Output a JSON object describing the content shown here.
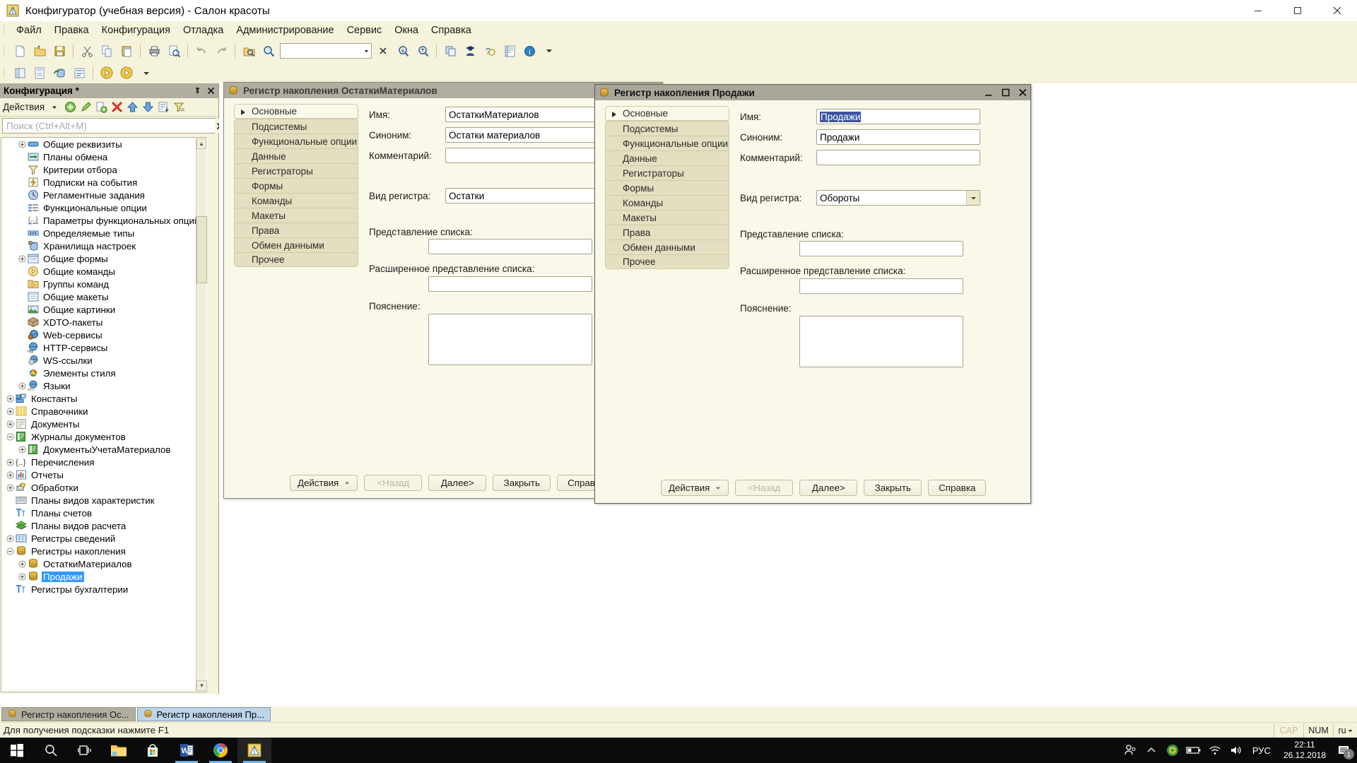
{
  "window": {
    "title": "Конфигуратор (учебная версия) - Салон красоты",
    "app_icon": "1c-configurator-icon",
    "minimize": "minimize-icon",
    "maximize": "maximize-icon",
    "close": "close-icon"
  },
  "menubar": {
    "items": [
      {
        "label": "Файл",
        "accel": "Ф"
      },
      {
        "label": "Правка",
        "accel": "П"
      },
      {
        "label": "Конфигурация",
        "accel": "К"
      },
      {
        "label": "Отладка",
        "accel": "О"
      },
      {
        "label": "Администрирование",
        "accel": "А"
      },
      {
        "label": "Сервис",
        "accel": "С"
      },
      {
        "label": "Окна",
        "accel": "О"
      },
      {
        "label": "Справка",
        "accel": "а"
      }
    ]
  },
  "toolbar": {
    "search_value": "",
    "row1_icons": [
      "new-document-icon",
      "open-folder-icon",
      "save-icon",
      "cut-icon",
      "copy-icon",
      "paste-icon",
      "print-icon",
      "print-preview-icon",
      "undo-icon",
      "redo-icon",
      "find-in-files-icon",
      "search-icon"
    ],
    "row1_icons_after": [
      "find-next-icon",
      "find-prev-icon",
      "window-copy-icon",
      "user-icon",
      "help-question-icon",
      "syntax-helper-icon",
      "info-icon",
      "toolbar-overflow-icon"
    ],
    "row2_icons": [
      "config-window-icon",
      "config-save-icon",
      "update-db-icon",
      "config-support-icon",
      "start-debug-icon",
      "start-client-icon",
      "toolbar-overflow-icon"
    ]
  },
  "config_panel": {
    "header_title": "Конфигурация *",
    "pin_icon": "pin-icon",
    "close_icon": "close-icon",
    "actions_label": "Действия",
    "action_icons": [
      "add-icon",
      "edit-icon",
      "copy-add-icon",
      "delete-icon",
      "move-up-icon",
      "move-down-icon",
      "sort-icon",
      "filter-icon"
    ],
    "search_placeholder": "Поиск (Ctrl+Alt+M)",
    "search_value": "",
    "search_clear_icon": "close-icon",
    "tree": [
      {
        "label": "Общие реквизиты",
        "indent": 1,
        "toggle": "plus",
        "icon": "common-attribute-icon",
        "selected": false
      },
      {
        "label": "Планы обмена",
        "indent": 1,
        "toggle": "none",
        "icon": "exchange-plans-icon",
        "selected": false
      },
      {
        "label": "Критерии отбора",
        "indent": 1,
        "toggle": "none",
        "icon": "filter-criteria-icon",
        "selected": false
      },
      {
        "label": "Подписки на события",
        "indent": 1,
        "toggle": "none",
        "icon": "event-subscription-icon",
        "selected": false
      },
      {
        "label": "Регламентные задания",
        "indent": 1,
        "toggle": "none",
        "icon": "scheduled-job-icon",
        "selected": false
      },
      {
        "label": "Функциональные опции",
        "indent": 1,
        "toggle": "none",
        "icon": "functional-option-icon",
        "selected": false
      },
      {
        "label": "Параметры функциональных опций",
        "indent": 1,
        "toggle": "none",
        "icon": "functional-option-param-icon",
        "selected": false
      },
      {
        "label": "Определяемые типы",
        "indent": 1,
        "toggle": "none",
        "icon": "defined-type-icon",
        "selected": false
      },
      {
        "label": "Хранилища настроек",
        "indent": 1,
        "toggle": "none",
        "icon": "settings-storage-icon",
        "selected": false
      },
      {
        "label": "Общие формы",
        "indent": 1,
        "toggle": "plus",
        "icon": "common-form-icon",
        "selected": false
      },
      {
        "label": "Общие команды",
        "indent": 1,
        "toggle": "none",
        "icon": "common-command-icon",
        "selected": false
      },
      {
        "label": "Группы команд",
        "indent": 1,
        "toggle": "none",
        "icon": "command-group-icon",
        "selected": false
      },
      {
        "label": "Общие макеты",
        "indent": 1,
        "toggle": "none",
        "icon": "common-template-icon",
        "selected": false
      },
      {
        "label": "Общие картинки",
        "indent": 1,
        "toggle": "none",
        "icon": "common-picture-icon",
        "selected": false
      },
      {
        "label": "XDTO-пакеты",
        "indent": 1,
        "toggle": "none",
        "icon": "xdto-package-icon",
        "selected": false
      },
      {
        "label": "Web-сервисы",
        "indent": 1,
        "toggle": "none",
        "icon": "web-service-icon",
        "selected": false
      },
      {
        "label": "HTTP-сервисы",
        "indent": 1,
        "toggle": "none",
        "icon": "http-service-icon",
        "selected": false
      },
      {
        "label": "WS-ссылки",
        "indent": 1,
        "toggle": "none",
        "icon": "ws-link-icon",
        "selected": false
      },
      {
        "label": "Элементы стиля",
        "indent": 1,
        "toggle": "none",
        "icon": "style-element-icon",
        "selected": false
      },
      {
        "label": "Языки",
        "indent": 1,
        "toggle": "plus",
        "icon": "language-icon",
        "selected": false
      },
      {
        "label": "Константы",
        "indent": 0,
        "toggle": "plus",
        "icon": "constant-icon",
        "selected": false
      },
      {
        "label": "Справочники",
        "indent": 0,
        "toggle": "plus",
        "icon": "catalog-icon",
        "selected": false
      },
      {
        "label": "Документы",
        "indent": 0,
        "toggle": "plus",
        "icon": "document-icon",
        "selected": false
      },
      {
        "label": "Журналы документов",
        "indent": 0,
        "toggle": "minus",
        "icon": "doc-journal-icon",
        "selected": false
      },
      {
        "label": "ДокументыУчетаМатериалов",
        "indent": 1,
        "toggle": "plus",
        "icon": "doc-journal-icon",
        "selected": false
      },
      {
        "label": "Перечисления",
        "indent": 0,
        "toggle": "plus",
        "icon": "enum-icon",
        "selected": false
      },
      {
        "label": "Отчеты",
        "indent": 0,
        "toggle": "plus",
        "icon": "report-icon",
        "selected": false
      },
      {
        "label": "Обработки",
        "indent": 0,
        "toggle": "plus",
        "icon": "data-processor-icon",
        "selected": false
      },
      {
        "label": "Планы видов характеристик",
        "indent": 0,
        "toggle": "none",
        "icon": "chart-of-char-types-icon",
        "selected": false
      },
      {
        "label": "Планы счетов",
        "indent": 0,
        "toggle": "none",
        "icon": "chart-of-accounts-icon",
        "selected": false
      },
      {
        "label": "Планы видов расчета",
        "indent": 0,
        "toggle": "none",
        "icon": "chart-of-calc-types-icon",
        "selected": false
      },
      {
        "label": "Регистры сведений",
        "indent": 0,
        "toggle": "plus",
        "icon": "info-register-icon",
        "selected": false
      },
      {
        "label": "Регистры накопления",
        "indent": 0,
        "toggle": "minus",
        "icon": "accum-register-icon",
        "selected": false
      },
      {
        "label": "ОстаткиМатериалов",
        "indent": 1,
        "toggle": "plus",
        "icon": "accum-register-icon",
        "selected": false
      },
      {
        "label": "Продажи",
        "indent": 1,
        "toggle": "plus",
        "icon": "accum-register-icon",
        "selected": true
      },
      {
        "label": "Регистры бухгалтерии",
        "indent": 0,
        "toggle": "none",
        "icon": "accounting-register-icon",
        "selected": false
      }
    ]
  },
  "dialog_ostatki": {
    "title": "Регистр накопления ОстаткиМатериалов",
    "icon": "accum-register-icon",
    "minimize": "minimize-icon",
    "maximize": "maximize-icon",
    "close": "close-icon",
    "nav_items": [
      {
        "label": "Основные",
        "active": true
      },
      {
        "label": "Подсистемы",
        "active": false
      },
      {
        "label": "Функциональные опции",
        "active": false
      },
      {
        "label": "Данные",
        "active": false
      },
      {
        "label": "Регистраторы",
        "active": false
      },
      {
        "label": "Формы",
        "active": false
      },
      {
        "label": "Команды",
        "active": false
      },
      {
        "label": "Макеты",
        "active": false
      },
      {
        "label": "Права",
        "active": false
      },
      {
        "label": "Обмен данными",
        "active": false
      },
      {
        "label": "Прочее",
        "active": false
      }
    ],
    "fields": {
      "name_label": "Имя:",
      "name_value": "ОстаткиМатериалов",
      "synonym_label": "Синоним:",
      "synonym_value": "Остатки материалов",
      "comment_label": "Комментарий:",
      "comment_value": "",
      "register_kind_label": "Вид регистра:",
      "register_kind_value": "Остатки",
      "list_presentation_label": "Представление списка:",
      "list_presentation_value": "",
      "extended_list_presentation_label": "Расширенное представление списка:",
      "extended_list_presentation_value": "",
      "explanation_label": "Пояснение:",
      "explanation_value": ""
    },
    "buttons": {
      "actions": "Действия",
      "back": "<Назад",
      "next": "Далее>",
      "close": "Закрыть",
      "help": "Справка"
    }
  },
  "dialog_prodazhi": {
    "title": "Регистр накопления Продажи",
    "icon": "accum-register-icon",
    "minimize": "minimize-icon",
    "maximize": "maximize-icon",
    "close": "close-icon",
    "nav_items": [
      {
        "label": "Основные",
        "active": true
      },
      {
        "label": "Подсистемы",
        "active": false
      },
      {
        "label": "Функциональные опции",
        "active": false
      },
      {
        "label": "Данные",
        "active": false
      },
      {
        "label": "Регистраторы",
        "active": false
      },
      {
        "label": "Формы",
        "active": false
      },
      {
        "label": "Команды",
        "active": false
      },
      {
        "label": "Макеты",
        "active": false
      },
      {
        "label": "Права",
        "active": false
      },
      {
        "label": "Обмен данными",
        "active": false
      },
      {
        "label": "Прочее",
        "active": false
      }
    ],
    "fields": {
      "name_label": "Имя:",
      "name_value": "Продажи",
      "name_selected": true,
      "synonym_label": "Синоним:",
      "synonym_value": "Продажи",
      "comment_label": "Комментарий:",
      "comment_value": "",
      "register_kind_label": "Вид регистра:",
      "register_kind_value": "Обороты",
      "list_presentation_label": "Представление списка:",
      "list_presentation_value": "",
      "extended_list_presentation_label": "Расширенное представление списка:",
      "extended_list_presentation_value": "",
      "explanation_label": "Пояснение:",
      "explanation_value": ""
    },
    "buttons": {
      "actions": "Действия",
      "back": "<Назад",
      "next": "Далее>",
      "close": "Закрыть",
      "help": "Справка"
    }
  },
  "window_tabs": [
    {
      "label": "Регистр накопления Ос...",
      "active": false,
      "icon": "accum-register-icon"
    },
    {
      "label": "Регистр накопления Пр...",
      "active": true,
      "icon": "accum-register-icon"
    }
  ],
  "statusbar": {
    "hint": "Для получения подсказки нажмите F1",
    "cap": "CAP",
    "num": "NUM",
    "lang": "ru"
  },
  "taskbar": {
    "items": [
      {
        "name": "start-button",
        "icon": "windows-logo-icon"
      },
      {
        "name": "search-button",
        "icon": "search-icon"
      },
      {
        "name": "task-view-button",
        "icon": "task-view-icon"
      },
      {
        "name": "file-explorer-button",
        "icon": "folder-icon"
      },
      {
        "name": "microsoft-store-button",
        "icon": "store-icon"
      },
      {
        "name": "word-button",
        "icon": "word-icon"
      },
      {
        "name": "chrome-button",
        "icon": "chrome-icon"
      },
      {
        "name": "1c-configurator-button",
        "icon": "1c-configurator-icon"
      }
    ],
    "tray": {
      "people_icon": "people-icon",
      "chevron_icon": "show-hidden-icons-icon",
      "shield_icon": "security-icon",
      "battery_icon": "battery-icon",
      "wifi_icon": "wifi-icon",
      "volume_icon": "volume-icon",
      "language": "РУС",
      "time": "22:11",
      "date": "26.12.2018",
      "notification_icon": "action-center-icon",
      "notification_count": "1"
    }
  },
  "colors": {
    "chrome": "#f5f3dc",
    "dialog_bg": "#faf8e8",
    "title_inactive": "#b1ada0",
    "selection": "#3b53a0",
    "tree_selection": "#3399ff",
    "tab_active": "#bcd4ea"
  }
}
